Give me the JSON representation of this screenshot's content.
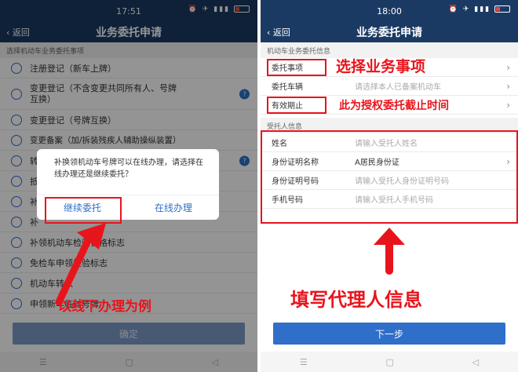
{
  "left": {
    "status_time": "17:51",
    "back_label": "返回",
    "title": "业务委托申请",
    "section_header": "选择机动车业务委托事项",
    "options": [
      "注册登记（新车上牌）",
      "变更登记（不含变更共同所有人、号牌\n互换）",
      "变更登记（号牌互换）",
      "变更备案（加/拆装残疾人辅助操纵装置）",
      "转",
      "抵",
      "补",
      "补",
      "补领机动车检验合格标志",
      "免检车申领检验标志",
      "机动车转入",
      "申领新车临时号牌"
    ],
    "confirm_label": "确定",
    "dialog": {
      "message": "补换领机动车号牌可以在线办理，请选择在线办理还是继续委托？",
      "continue_label": "继续委托",
      "online_label": "在线办理"
    },
    "annotation": "以线下办理为例"
  },
  "right": {
    "status_time": "18:00",
    "back_label": "返回",
    "title": "业务委托申请",
    "section1": "机动车业务委托信息",
    "rows1": [
      {
        "label": "委托事项",
        "value": ""
      },
      {
        "label": "委托车辆",
        "value": "请选择本人已备案机动车"
      },
      {
        "label": "有效期止",
        "value": ""
      }
    ],
    "section2": "受托人信息",
    "rows2": [
      {
        "label": "姓名",
        "value": "请输入受托人姓名"
      },
      {
        "label": "身份证明名称",
        "value": "A居民身份证"
      },
      {
        "label": "身份证明号码",
        "value": "请输入受托人身份证明号码"
      },
      {
        "label": "手机号码",
        "value": "请输入受托人手机号码"
      }
    ],
    "next_label": "下一步",
    "annotation_select": "选择业务事项",
    "annotation_date": "此为授权委托截止时间",
    "annotation_fill": "填写代理人信息"
  },
  "colors": {
    "navbar": "#1b3a63",
    "accent": "#2f6fc9",
    "annotation": "#e8141c"
  }
}
